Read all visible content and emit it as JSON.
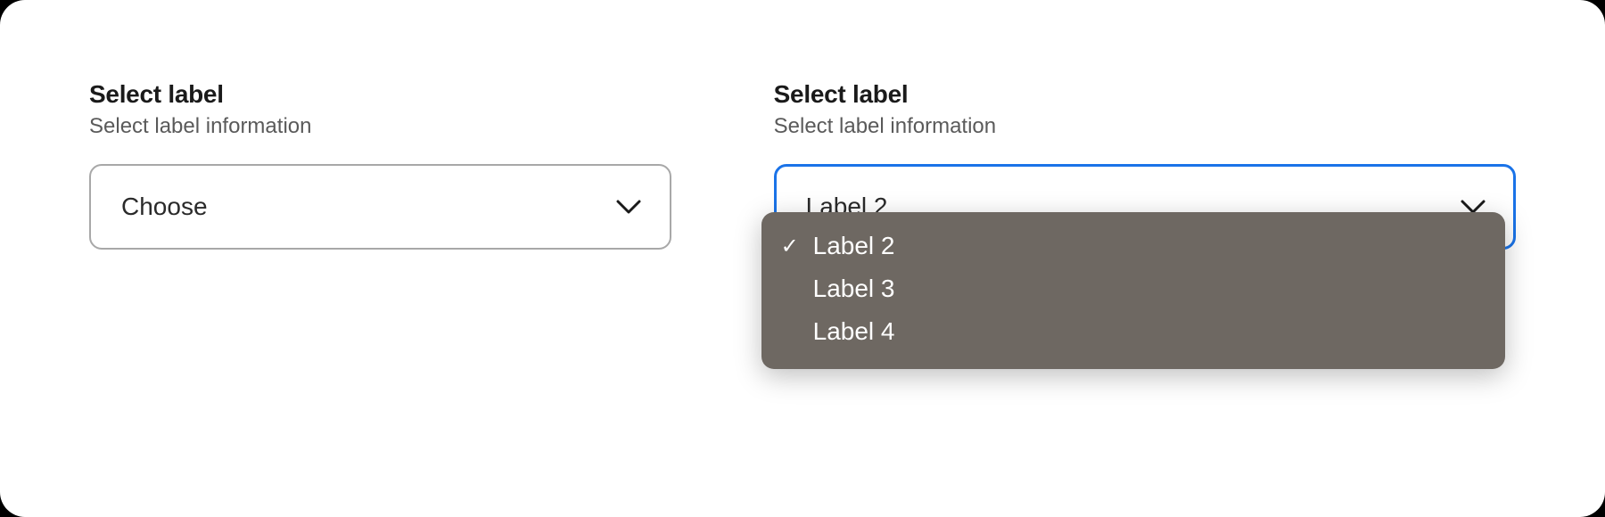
{
  "left": {
    "title": "Select label",
    "description": "Select label information",
    "value": "Choose"
  },
  "right": {
    "title": "Select label",
    "description": "Select label information",
    "value": "Label 2",
    "options": [
      {
        "label": "Label 2",
        "selected": true
      },
      {
        "label": "Label 3",
        "selected": false
      },
      {
        "label": "Label 4",
        "selected": false
      }
    ]
  },
  "icons": {
    "check": "✓"
  }
}
